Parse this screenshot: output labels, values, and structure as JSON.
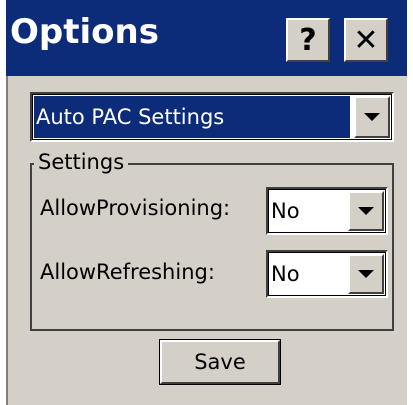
{
  "window": {
    "title": "Options",
    "help_label": "?",
    "close_label": "✕"
  },
  "page_selector": {
    "value": "Auto PAC Settings",
    "icon": "chevron-down-icon"
  },
  "settings_group": {
    "label": "Settings",
    "fields": [
      {
        "label": "AllowProvisioning:",
        "value": "No"
      },
      {
        "label": "AllowRefreshing:",
        "value": "No"
      }
    ]
  },
  "actions": {
    "save_label": "Save"
  },
  "colors": {
    "titlebar": "#0c2c7a",
    "face": "#d4d0c8",
    "selection": "#0c2c7a"
  }
}
